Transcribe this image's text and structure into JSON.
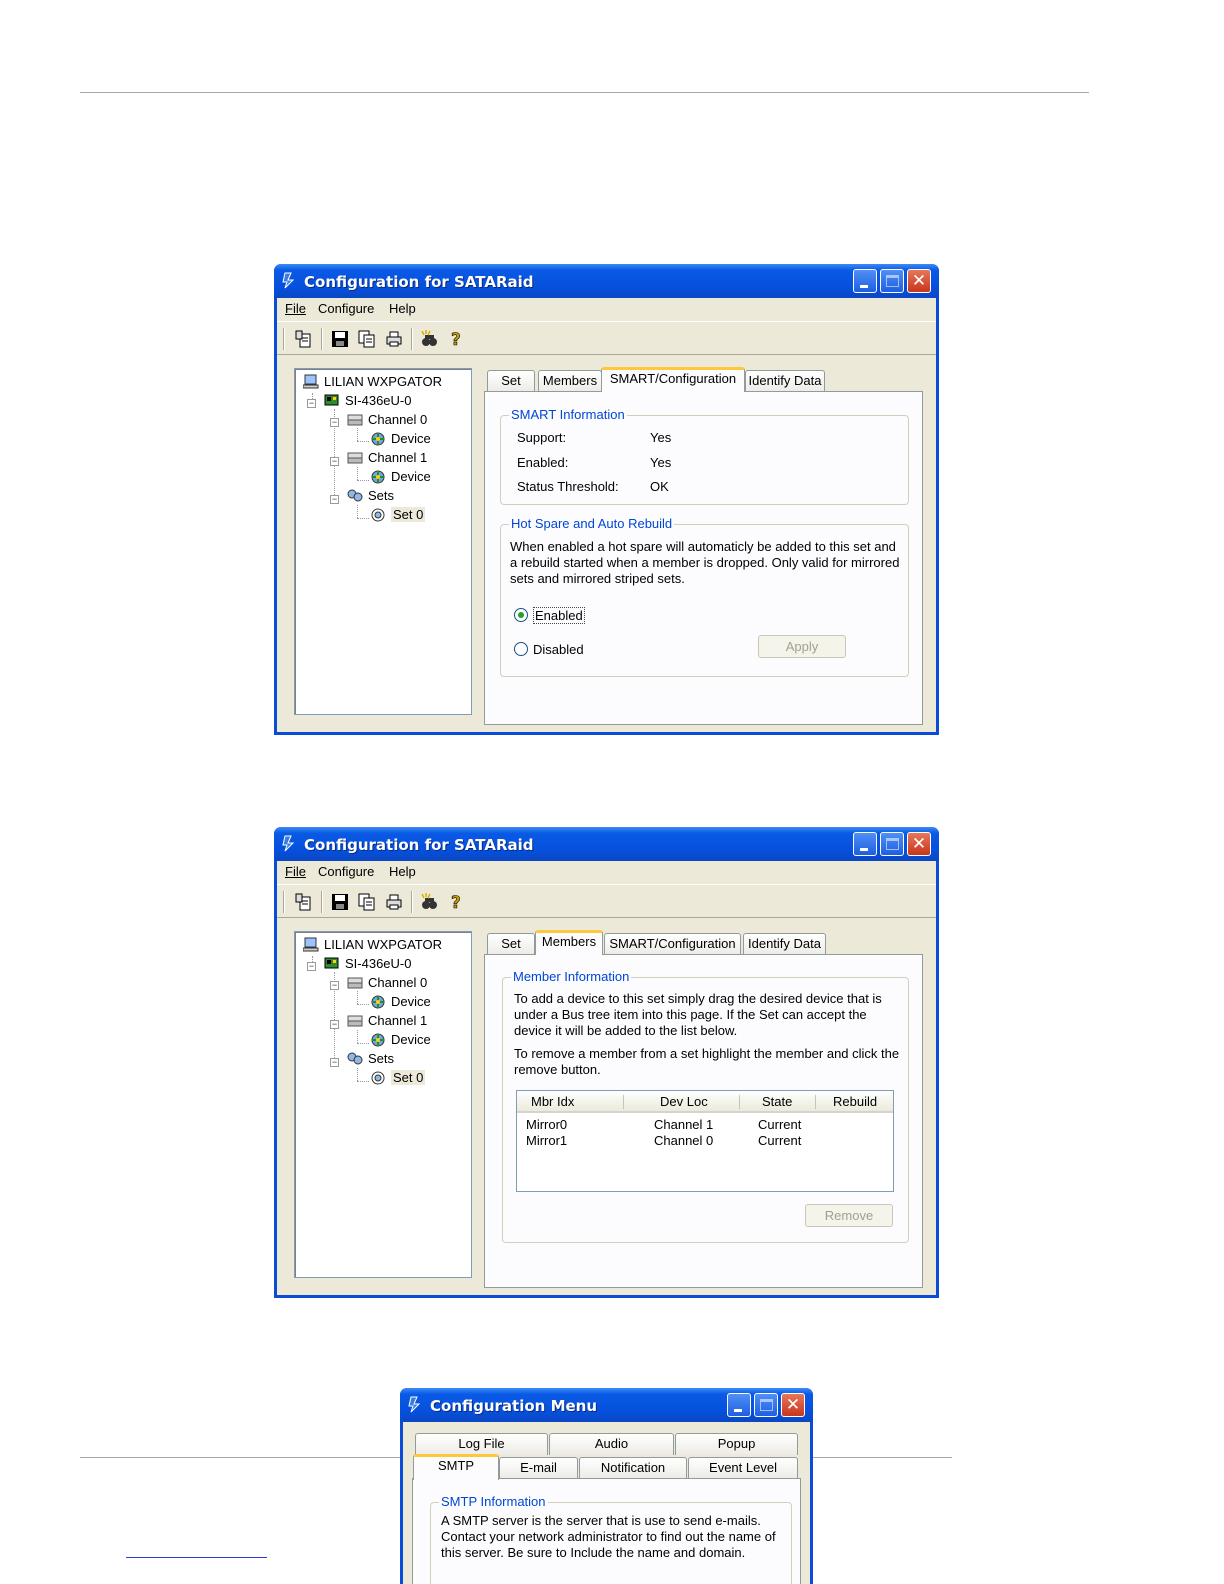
{
  "window1": {
    "title": "Configuration for SATARaid",
    "menus": {
      "file": "File",
      "configure": "Configure",
      "help": "Help"
    },
    "toolbar_icons": [
      "properties-icon",
      "save-icon",
      "copy-icon",
      "print-icon",
      "find-icon",
      "help-icon"
    ],
    "tree": {
      "root": "LILIAN WXPGATOR",
      "controller": "SI-436eU-0",
      "channel0": "Channel 0",
      "device0": "Device",
      "channel1": "Channel 1",
      "device1": "Device",
      "sets": "Sets",
      "set0": "Set 0"
    },
    "tabs": {
      "set": "Set",
      "members": "Members",
      "smart": "SMART/Configuration",
      "identify": "Identify Data"
    },
    "smart_group": {
      "legend": "SMART Information",
      "support_label": "Support:",
      "support_value": "Yes",
      "enabled_label": "Enabled:",
      "enabled_value": "Yes",
      "threshold_label": "Status Threshold:",
      "threshold_value": "OK"
    },
    "hotspare_group": {
      "legend": "Hot Spare and Auto Rebuild",
      "description": "When enabled a hot spare will automaticly be added to this set and a rebuild started when a member is dropped. Only valid for mirrored sets and mirrored striped sets.",
      "enabled_label": "Enabled",
      "disabled_label": "Disabled",
      "selected": "Enabled",
      "apply_label": "Apply"
    }
  },
  "window2": {
    "title": "Configuration for SATARaid",
    "menus": {
      "file": "File",
      "configure": "Configure",
      "help": "Help"
    },
    "tree": {
      "root": "LILIAN WXPGATOR",
      "controller": "SI-436eU-0",
      "channel0": "Channel 0",
      "device0": "Device",
      "channel1": "Channel 1",
      "device1": "Device",
      "sets": "Sets",
      "set0": "Set 0"
    },
    "tabs": {
      "set": "Set",
      "members": "Members",
      "smart": "SMART/Configuration",
      "identify": "Identify Data"
    },
    "member_group": {
      "legend": "Member Information",
      "para1": "To add a device to this set simply drag the desired device that is under a Bus tree item into this page.  If the Set can accept the device it will be added to the list below.",
      "para2": "To remove a member from a set highlight the member and click the remove button.",
      "columns": [
        "Mbr Idx",
        "Dev Loc",
        "State",
        "Rebuild"
      ],
      "rows": [
        {
          "idx": "Mirror0",
          "loc": "Channel 1",
          "state": "Current",
          "rebuild": ""
        },
        {
          "idx": "Mirror1",
          "loc": "Channel 0",
          "state": "Current",
          "rebuild": ""
        }
      ],
      "remove_label": "Remove"
    }
  },
  "window3": {
    "title": "Configuration Menu",
    "tabs_back": [
      "Log File",
      "Audio",
      "Popup"
    ],
    "tabs_front": [
      "SMTP",
      "E-mail",
      "Notification",
      "Event Level"
    ],
    "smtp_group": {
      "legend": "SMTP Information",
      "description": "A SMTP server is the server that is use to send e-mails. Contact your network administrator to find out the name of this server. Be sure to Include the name and domain."
    }
  }
}
